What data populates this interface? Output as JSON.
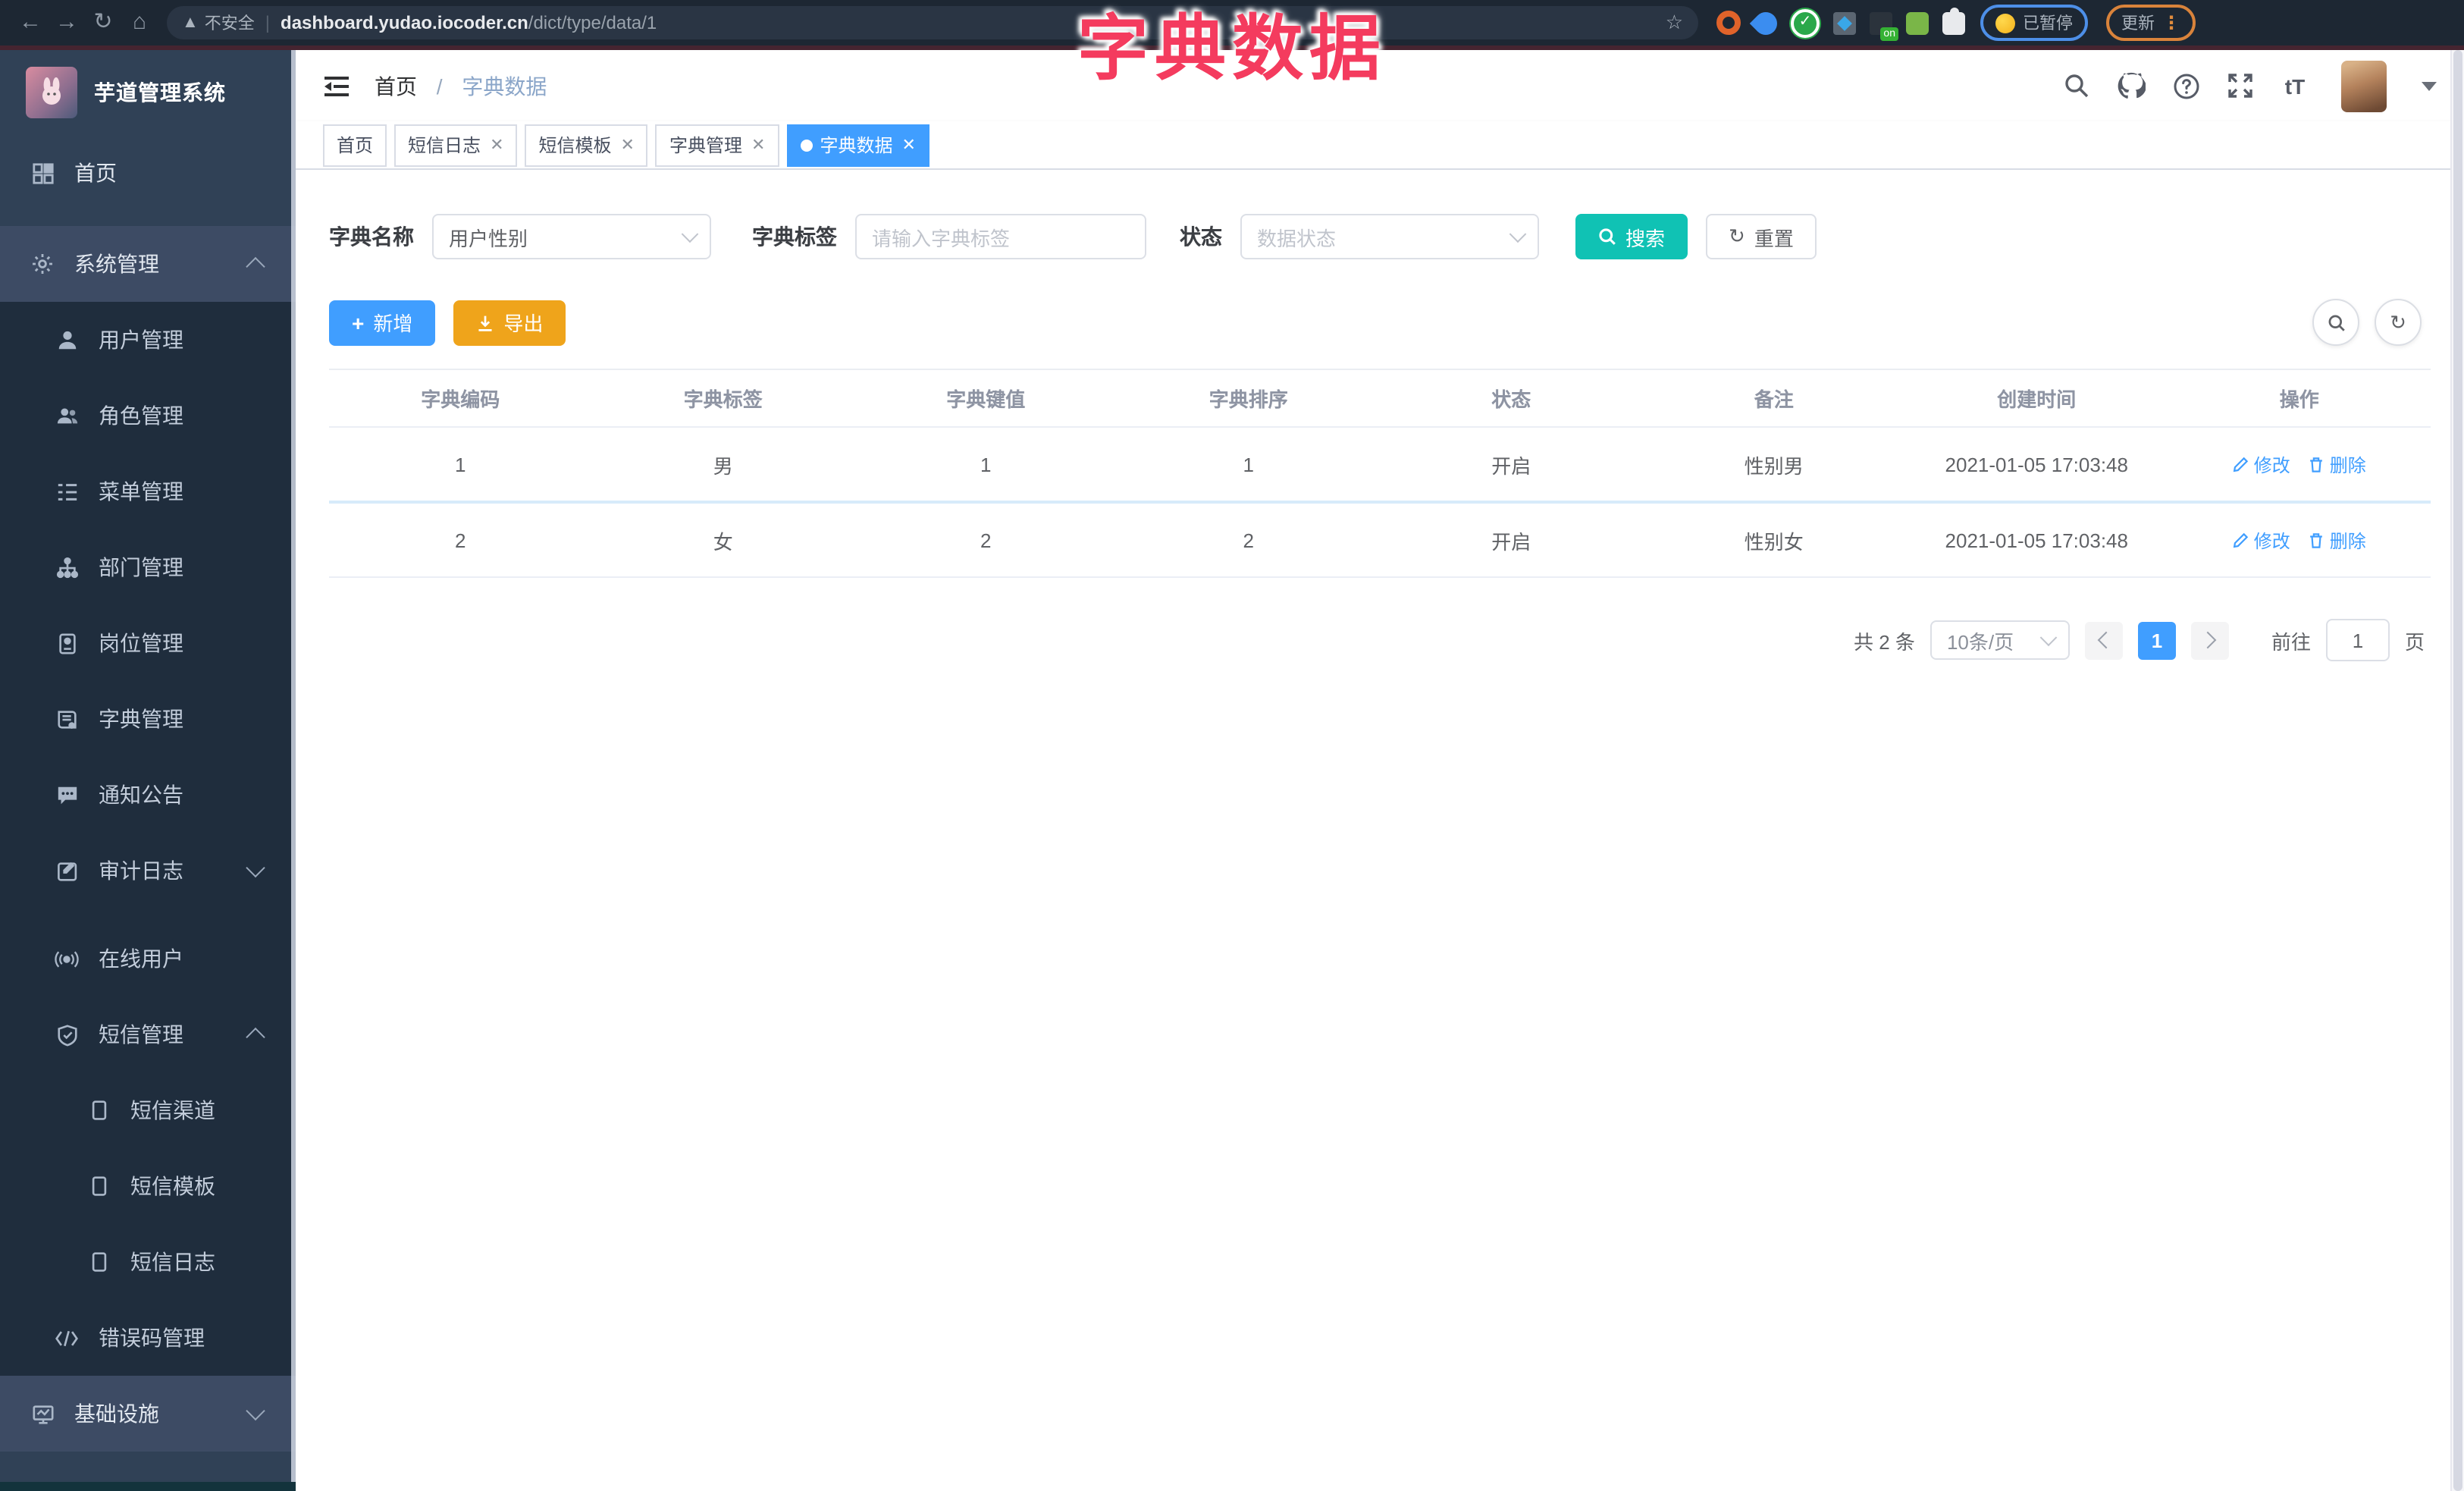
{
  "browser": {
    "not_secure": "不安全",
    "host": "dashboard.yudao.iocoder.cn",
    "path": "/dict/type/data/1",
    "on_badge": "on",
    "paused_label": "已暂停",
    "update_label": "更新"
  },
  "annotation": {
    "title": "字典数据",
    "color": "#f43b5e"
  },
  "sidebar": {
    "logo_title": "芋道管理系统",
    "items": [
      {
        "label": "首页",
        "icon": "dashboard-icon"
      },
      {
        "label": "系统管理",
        "icon": "gear-icon",
        "arrow": "up"
      },
      {
        "label": "用户管理",
        "icon": "user-icon"
      },
      {
        "label": "角色管理",
        "icon": "users-icon"
      },
      {
        "label": "菜单管理",
        "icon": "menu-list-icon"
      },
      {
        "label": "部门管理",
        "icon": "org-tree-icon"
      },
      {
        "label": "岗位管理",
        "icon": "id-badge-icon"
      },
      {
        "label": "字典管理",
        "icon": "dictionary-icon"
      },
      {
        "label": "通知公告",
        "icon": "announcement-icon"
      },
      {
        "label": "审计日志",
        "icon": "audit-log-icon",
        "arrow": "down"
      },
      {
        "label": "在线用户",
        "icon": "online-users-icon"
      },
      {
        "label": "短信管理",
        "icon": "sms-shield-icon",
        "arrow": "up"
      },
      {
        "label": "短信渠道",
        "icon": "phone-icon"
      },
      {
        "label": "短信模板",
        "icon": "phone-icon"
      },
      {
        "label": "短信日志",
        "icon": "phone-icon"
      },
      {
        "label": "错误码管理",
        "icon": "code-icon"
      },
      {
        "label": "基础设施",
        "icon": "infrastructure-icon",
        "arrow": "down"
      }
    ]
  },
  "navbar": {
    "breadcrumb_home": "首页",
    "breadcrumb_sep": "/",
    "breadcrumb_current": "字典数据"
  },
  "tabs": [
    {
      "label": "首页",
      "closable": false,
      "active": false
    },
    {
      "label": "短信日志",
      "closable": true,
      "active": false
    },
    {
      "label": "短信模板",
      "closable": true,
      "active": false
    },
    {
      "label": "字典管理",
      "closable": true,
      "active": false
    },
    {
      "label": "字典数据",
      "closable": true,
      "active": true
    }
  ],
  "filters": {
    "name_label": "字典名称",
    "name_value": "用户性别",
    "tag_label": "字典标签",
    "tag_placeholder": "请输入字典标签",
    "status_label": "状态",
    "status_placeholder": "数据状态",
    "search_label": "搜索",
    "reset_label": "重置"
  },
  "toolbar": {
    "add_label": "新增",
    "export_label": "导出"
  },
  "table": {
    "headers": [
      "字典编码",
      "字典标签",
      "字典键值",
      "字典排序",
      "状态",
      "备注",
      "创建时间",
      "操作"
    ],
    "rows": [
      {
        "code": "1",
        "label": "男",
        "value": "1",
        "sort": "1",
        "status": "开启",
        "remark": "性别男",
        "created": "2021-01-05 17:03:48"
      },
      {
        "code": "2",
        "label": "女",
        "value": "2",
        "sort": "2",
        "status": "开启",
        "remark": "性别女",
        "created": "2021-01-05 17:03:48"
      }
    ],
    "edit_label": "修改",
    "delete_label": "删除"
  },
  "pagination": {
    "total": "共 2 条",
    "page_size": "10条/页",
    "current_page": "1",
    "jump_label": "前往",
    "jump_value": "1",
    "jump_suffix": "页"
  },
  "colors": {
    "accent": "#409eff",
    "search": "#10c2b4",
    "export": "#efa41b",
    "annotation": "#f43b5e",
    "sidebar_bg": "#304156",
    "submenu_bg": "#1f2d3d"
  }
}
